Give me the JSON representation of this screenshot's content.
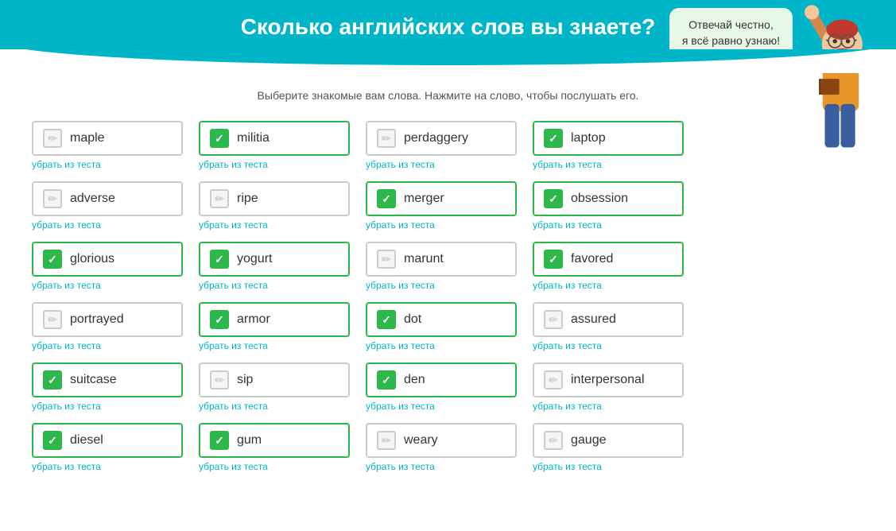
{
  "header": {
    "title": "Сколько английских слов вы знаете?",
    "bubble_line1": "Отвечай честно,",
    "bubble_line2": "я всё равно узнаю!"
  },
  "instruction": "Выберите знакомые вам слова. Нажмите на слово, чтобы послушать его.",
  "remove_text": "убрать из теста",
  "words": [
    {
      "id": "maple",
      "label": "maple",
      "checked": false
    },
    {
      "id": "militia",
      "label": "militia",
      "checked": true
    },
    {
      "id": "perdaggery",
      "label": "perdaggery",
      "checked": false
    },
    {
      "id": "laptop",
      "label": "laptop",
      "checked": true
    },
    {
      "id": "adverse",
      "label": "adverse",
      "checked": false
    },
    {
      "id": "ripe",
      "label": "ripe",
      "checked": false
    },
    {
      "id": "merger",
      "label": "merger",
      "checked": true
    },
    {
      "id": "obsession",
      "label": "obsession",
      "checked": true
    },
    {
      "id": "glorious",
      "label": "glorious",
      "checked": true
    },
    {
      "id": "yogurt",
      "label": "yogurt",
      "checked": true
    },
    {
      "id": "marunt",
      "label": "marunt",
      "checked": false
    },
    {
      "id": "favored",
      "label": "favored",
      "checked": true
    },
    {
      "id": "portrayed",
      "label": "portrayed",
      "checked": false
    },
    {
      "id": "armor",
      "label": "armor",
      "checked": true
    },
    {
      "id": "dot",
      "label": "dot",
      "checked": true
    },
    {
      "id": "assured",
      "label": "assured",
      "checked": false
    },
    {
      "id": "suitcase",
      "label": "suitcase",
      "checked": true
    },
    {
      "id": "sip",
      "label": "sip",
      "checked": false
    },
    {
      "id": "den",
      "label": "den",
      "checked": true
    },
    {
      "id": "interpersonal",
      "label": "interpersonal",
      "checked": false
    },
    {
      "id": "diesel",
      "label": "diesel",
      "checked": true
    },
    {
      "id": "gum",
      "label": "gum",
      "checked": true
    },
    {
      "id": "weary",
      "label": "weary",
      "checked": false
    },
    {
      "id": "gauge",
      "label": "gauge",
      "checked": false
    }
  ]
}
